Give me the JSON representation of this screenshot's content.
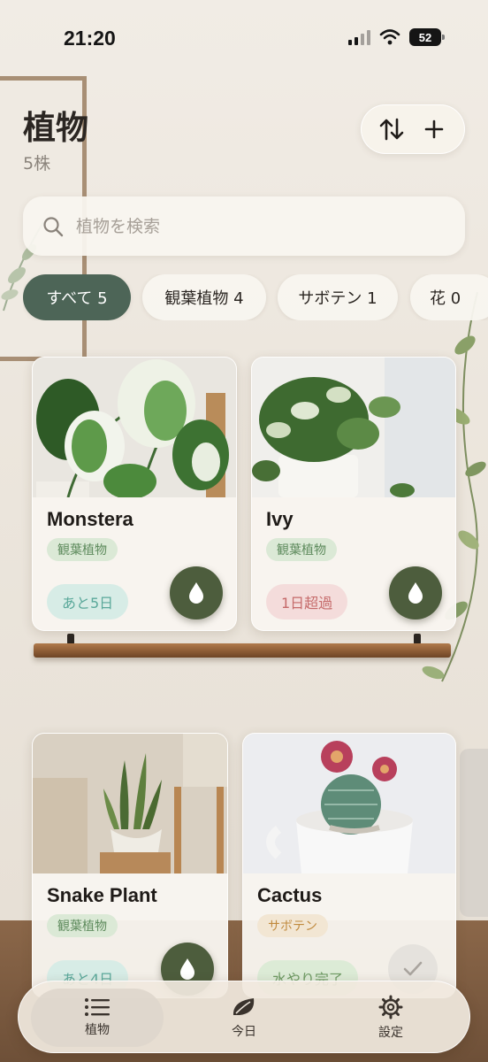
{
  "status_bar": {
    "time": "21:20",
    "battery": "52"
  },
  "header": {
    "title": "植物",
    "count": "5株"
  },
  "search": {
    "placeholder": "植物を検索"
  },
  "filters": [
    {
      "label": "すべて 5",
      "active": true
    },
    {
      "label": "観葉植物 4",
      "active": false
    },
    {
      "label": "サボテン 1",
      "active": false
    },
    {
      "label": "花 0",
      "active": false
    }
  ],
  "plants": [
    {
      "name": "Monstera",
      "category": "観葉植物",
      "status": "あと5日",
      "action": "water"
    },
    {
      "name": "Ivy",
      "category": "観葉植物",
      "status": "1日超過",
      "action": "water"
    },
    {
      "name": "Snake Plant",
      "category": "観葉植物",
      "status": "あと4日",
      "action": "water"
    },
    {
      "name": "Cactus",
      "category": "サボテン",
      "status": "水やり完了",
      "action": "done"
    }
  ],
  "tabs": [
    {
      "label": "植物",
      "icon": "list-icon",
      "active": true
    },
    {
      "label": "今日",
      "icon": "leaf-icon",
      "active": false
    },
    {
      "label": "設定",
      "icon": "gear-icon",
      "active": false
    }
  ],
  "colors": {
    "accent_green": "#4d6557",
    "water_button": "#4d5d3d",
    "tag_green": "#5d8a5c",
    "tag_orange": "#c08a3e",
    "status_teal": "#5aa89a",
    "status_red": "#c56a6a"
  }
}
